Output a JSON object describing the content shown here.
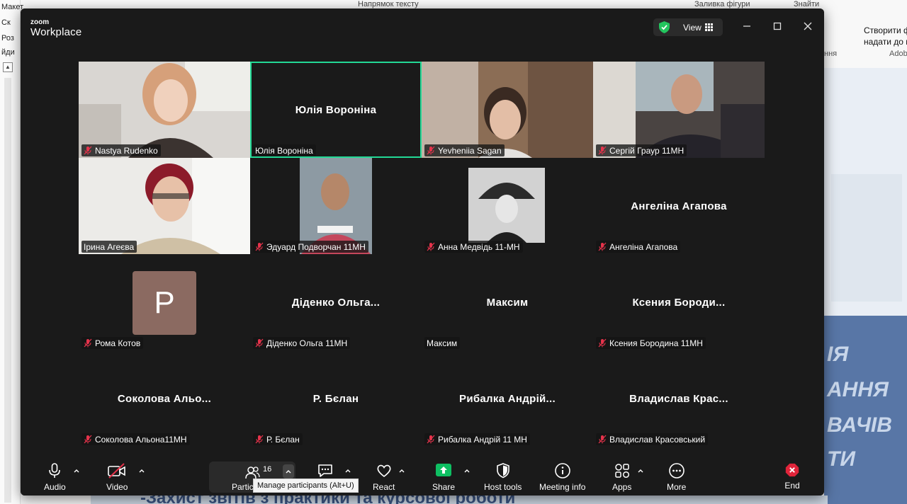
{
  "background": {
    "left_menu": [
      "Макет",
      "Ск",
      "Роз",
      "йди"
    ],
    "top_strip": [
      "Напрямок тексту",
      "Заливка фігури",
      "Знайти"
    ],
    "right_panel": [
      "Створити ф",
      "надати до нього",
      "Adob",
      "ння"
    ],
    "slide_words": [
      "ІЯ",
      "АННЯ",
      "ВАЧІВ",
      "ТИ"
    ],
    "bottom_banner": "-Захист звітів з практики та курсової роботи"
  },
  "window": {
    "brand_small": "zoom",
    "brand_big": "Workplace",
    "view_label": "View"
  },
  "tiles": [
    {
      "name_tag": "Nastya Rudenko",
      "muted": true,
      "video": true,
      "big_name": ""
    },
    {
      "name_tag": "Юлія Вороніна",
      "muted": false,
      "video": false,
      "big_name": "Юлія Вороніна",
      "active": true
    },
    {
      "name_tag": "Yevheniia Sagan",
      "muted": true,
      "video": true,
      "big_name": ""
    },
    {
      "name_tag": "Сергій Граур 11МН",
      "muted": true,
      "video": true,
      "big_name": ""
    },
    {
      "name_tag": "Ірина Агеєва",
      "muted": false,
      "video": true,
      "big_name": ""
    },
    {
      "name_tag": "Эдуард Подворчан 11МН",
      "muted": true,
      "video": true,
      "big_name": ""
    },
    {
      "name_tag": "Анна Медвідь 11-МН",
      "muted": true,
      "video": true,
      "big_name": ""
    },
    {
      "name_tag": "Ангеліна Агапова",
      "muted": true,
      "video": false,
      "big_name": "Ангеліна Агапова"
    },
    {
      "name_tag": "Рома Котов",
      "muted": true,
      "video": false,
      "big_name": "",
      "avatar": "P"
    },
    {
      "name_tag": "Діденко Ольга 11МН",
      "muted": true,
      "video": false,
      "big_name": "Діденко  Ольга..."
    },
    {
      "name_tag": "Максим",
      "muted": false,
      "video": false,
      "big_name": "Максим"
    },
    {
      "name_tag": "Ксения Бородина 11МН",
      "muted": true,
      "video": false,
      "big_name": "Ксения  Бороди..."
    },
    {
      "name_tag": "Соколова Альона11МН",
      "muted": true,
      "video": false,
      "big_name": "Соколова  Альо..."
    },
    {
      "name_tag": "Р. Бєлан",
      "muted": true,
      "video": false,
      "big_name": "Р. Бєлан"
    },
    {
      "name_tag": "Рибалка Андрій 11 МН",
      "muted": true,
      "video": false,
      "big_name": "Рибалка  Андрій..."
    },
    {
      "name_tag": "Владислав Красовський",
      "muted": true,
      "video": false,
      "big_name": "Владислав  Крас..."
    }
  ],
  "toolbar": {
    "audio": "Audio",
    "video": "Video",
    "participants": "Partic",
    "participants_count": "16",
    "participants_tooltip": "Manage participants (Alt+U)",
    "react": "React",
    "share": "Share",
    "host_tools": "Host tools",
    "meeting_info": "Meeting info",
    "apps": "Apps",
    "more": "More",
    "end": "End"
  },
  "colors": {
    "window_bg": "#1a1a1a",
    "active_speaker": "#23d996",
    "share_green": "#0ebf62",
    "end_red": "#e0243a",
    "avatar_bg": "#8b6a61"
  }
}
